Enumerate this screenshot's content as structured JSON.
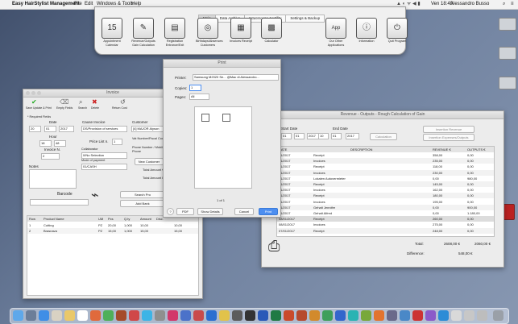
{
  "menubar": {
    "app_name": "Easy HairStylist Management",
    "items": [
      "File",
      "Edit",
      "Windows & Tools",
      "Help"
    ],
    "clock": "Ven 18:49",
    "user": "Alessandro Busso"
  },
  "launcher": {
    "tabs": [
      "Main",
      "Data Archive",
      "WareHouse & Utility",
      "Settings & Backup"
    ],
    "icons": [
      {
        "label": "Appointment Calendar",
        "glyph": "15"
      },
      {
        "label": "Revenue/Outputs Gain Calculation",
        "glyph": "✎"
      },
      {
        "label": "Registration Entrance/Exit",
        "glyph": "▤"
      },
      {
        "label": "Birthdays/Absences Customers",
        "glyph": "◎"
      },
      {
        "label": "Invoices Receipt",
        "glyph": "▦"
      },
      {
        "label": "Calculator",
        "glyph": "▩"
      },
      {
        "label": "Our Other Applications",
        "glyph": "App"
      },
      {
        "label": "Information",
        "glyph": "ⓘ"
      },
      {
        "label": "Quit Program",
        "glyph": "⏻"
      }
    ]
  },
  "invoice": {
    "title": "Invoice",
    "toolbar": [
      "Save Update & Print",
      "Empty Fields",
      "Search",
      "Delete",
      "Return Cost"
    ],
    "required": "* Required Fields",
    "date_label": "Date",
    "date": {
      "day": "20",
      "month": "01",
      "year": "2017"
    },
    "cause_label": "Cause Invoice",
    "cause_value": "DS/Provision of services",
    "customer_label": "Customer",
    "customer_value": "[4] MAJOR Alyson",
    "vat_label": "Vat Number/Fiscal Code",
    "phone_label": "Phone Number / Mobile Phone",
    "hour_label": "Hour",
    "hour": "18",
    "minute": "48",
    "price_list_label": "Price List n.",
    "price_list": "1",
    "invoice_n_label": "Invoice N.",
    "invoice_n": "2",
    "collaborator_label": "Collaborator",
    "collaborator_value": "0/No Selection",
    "payment_label": "Mode of payment",
    "payment_value": "01/CASH",
    "notes_label": "Notes",
    "new_customer": "New Customer",
    "total_amount": "Total Amount €",
    "total_discount": "Total Amount Disc",
    "barcode_label": "Barcode",
    "search_product": "Search Pro",
    "add_bank": "Add Bank",
    "columns": [
      "Row",
      "Product Name",
      "UM",
      "Pcs",
      "Q.ty",
      "Amount",
      "Disc."
    ],
    "rows": [
      {
        "row": "1",
        "name": "Cutting",
        "um": "PZ",
        "pcs": "20,00",
        "qty": "1,000",
        "amount": "10,00",
        "disc": "10,00"
      },
      {
        "row": "2",
        "name": "Brasnava",
        "um": "PZ",
        "pcs": "15,00",
        "qty": "1,000",
        "amount": "15,00",
        "disc": "15,00"
      }
    ]
  },
  "print": {
    "title": "Print",
    "printer_label": "Printer:",
    "printer_value": "Samsung M2020 Se... @Mac di Alessandro...",
    "copies_label": "Copies:",
    "copies_value": "1",
    "pages_label": "Pages:",
    "pages_value": "All",
    "page_indicator": "1 of 1",
    "pdf": "PDF",
    "show_details": "Show Details",
    "cancel": "Cancel",
    "print_btn": "Print",
    "help": "?"
  },
  "revenue": {
    "title": "Revenue - Outputs - Rough Calculation of Gain",
    "start_label": "Start Date",
    "start": {
      "day": "01",
      "month": "01",
      "year": "2017"
    },
    "end_label": "End Date",
    "end": {
      "day": "10",
      "month": "01",
      "year": "2017"
    },
    "calculation": "Calculation",
    "insertion_revenue": "Insertion Revenue",
    "insertion_expenses": "Insertion Expenses/Outputs",
    "columns": [
      "DATE",
      "DESCRIPTION",
      "REVENUE €",
      "OUTPUTS €"
    ],
    "rows": [
      {
        "date": "01/2017",
        "desc": "Receipt",
        "rev": "358,00",
        "out": "0,00"
      },
      {
        "date": "01/2017",
        "desc": "Invoices",
        "rev": "235,00",
        "out": "0,00"
      },
      {
        "date": "01/2017",
        "desc": "Receipt",
        "rev": "118,00",
        "out": "0,00"
      },
      {
        "date": "01/2017",
        "desc": "Invoices",
        "rev": "230,00",
        "out": "0,00"
      },
      {
        "date": "01/2017",
        "desc": "Lokalen Autovermieter",
        "rev": "0,00",
        "out": "980,00"
      },
      {
        "date": "01/2017",
        "desc": "Receipt",
        "rev": "145,00",
        "out": "0,00"
      },
      {
        "date": "01/2017",
        "desc": "Invoices",
        "rev": "162,00",
        "out": "0,00"
      },
      {
        "date": "01/2017",
        "desc": "Receipt",
        "rev": "180,00",
        "out": "0,00"
      },
      {
        "date": "01/2017",
        "desc": "Invoices",
        "rev": "195,00",
        "out": "0,00"
      },
      {
        "date": "01/2017",
        "desc": "Gehalt Jennifer",
        "rev": "0,00",
        "out": "900,00"
      },
      {
        "date": "01/2017",
        "desc": "Gehalt Alfred",
        "rev": "0,00",
        "out": "1.180,00"
      },
      {
        "date": "08/01/2017",
        "desc": "Receipt",
        "rev": "260,00",
        "out": "0,00"
      },
      {
        "date": "08/01/2017",
        "desc": "Invoices",
        "rev": "275,00",
        "out": "0,00"
      },
      {
        "date": "07/01/2017",
        "desc": "Receipt",
        "rev": "248,00",
        "out": "0,00"
      }
    ],
    "total_label": "Total:",
    "total_revenue": "2608,00 €",
    "total_outputs": "2060,00 €",
    "difference_label": "Difference:",
    "difference": "548,00 €"
  }
}
